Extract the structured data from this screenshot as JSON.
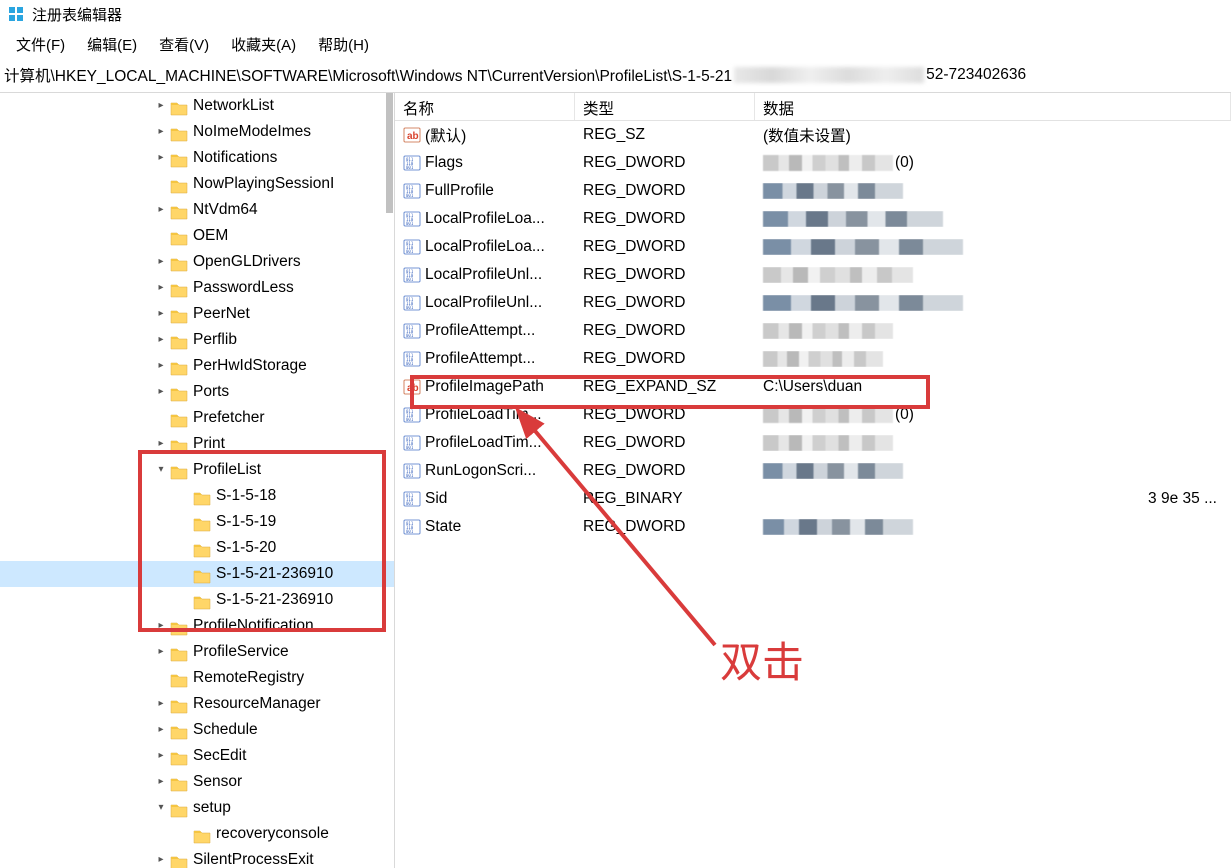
{
  "window": {
    "title": "注册表编辑器"
  },
  "menubar": {
    "file": "文件(F)",
    "edit": "编辑(E)",
    "view": "查看(V)",
    "favorites": "收藏夹(A)",
    "help": "帮助(H)"
  },
  "addressbar": {
    "path_prefix": "计算机\\HKEY_LOCAL_MACHINE\\SOFTWARE\\Microsoft\\Windows NT\\CurrentVersion\\ProfileList\\S-1-5-21",
    "path_suffix": "52-723402636"
  },
  "tree": {
    "items": [
      {
        "indent": 155,
        "expander": ">",
        "label": "NetworkList"
      },
      {
        "indent": 155,
        "expander": ">",
        "label": "NoImeModeImes"
      },
      {
        "indent": 155,
        "expander": ">",
        "label": "Notifications"
      },
      {
        "indent": 155,
        "expander": "",
        "label": "NowPlayingSessionI"
      },
      {
        "indent": 155,
        "expander": ">",
        "label": "NtVdm64"
      },
      {
        "indent": 155,
        "expander": "",
        "label": "OEM"
      },
      {
        "indent": 155,
        "expander": ">",
        "label": "OpenGLDrivers"
      },
      {
        "indent": 155,
        "expander": ">",
        "label": "PasswordLess"
      },
      {
        "indent": 155,
        "expander": ">",
        "label": "PeerNet"
      },
      {
        "indent": 155,
        "expander": ">",
        "label": "Perflib"
      },
      {
        "indent": 155,
        "expander": ">",
        "label": "PerHwIdStorage"
      },
      {
        "indent": 155,
        "expander": ">",
        "label": "Ports"
      },
      {
        "indent": 155,
        "expander": "",
        "label": "Prefetcher"
      },
      {
        "indent": 155,
        "expander": ">",
        "label": "Print"
      },
      {
        "indent": 155,
        "expander": "v",
        "label": "ProfileList"
      },
      {
        "indent": 178,
        "expander": "",
        "label": "S-1-5-18"
      },
      {
        "indent": 178,
        "expander": "",
        "label": "S-1-5-19"
      },
      {
        "indent": 178,
        "expander": "",
        "label": "S-1-5-20"
      },
      {
        "indent": 178,
        "expander": "",
        "label": "S-1-5-21-236910",
        "selected": true
      },
      {
        "indent": 178,
        "expander": "",
        "label": "S-1-5-21-236910"
      },
      {
        "indent": 155,
        "expander": ">",
        "label": "ProfileNotification"
      },
      {
        "indent": 155,
        "expander": ">",
        "label": "ProfileService"
      },
      {
        "indent": 155,
        "expander": "",
        "label": "RemoteRegistry"
      },
      {
        "indent": 155,
        "expander": ">",
        "label": "ResourceManager"
      },
      {
        "indent": 155,
        "expander": ">",
        "label": "Schedule"
      },
      {
        "indent": 155,
        "expander": ">",
        "label": "SecEdit"
      },
      {
        "indent": 155,
        "expander": ">",
        "label": "Sensor"
      },
      {
        "indent": 155,
        "expander": "v",
        "label": "setup"
      },
      {
        "indent": 178,
        "expander": "",
        "label": "recoveryconsole"
      },
      {
        "indent": 155,
        "expander": ">",
        "label": "SilentProcessExit"
      }
    ]
  },
  "list": {
    "columns": {
      "name": "名称",
      "type": "类型",
      "data": "数据"
    },
    "rows": [
      {
        "icon": "ab",
        "name": "(默认)",
        "type": "REG_SZ",
        "data_text": "(数值未设置)",
        "pixelated": false
      },
      {
        "icon": "bin",
        "name": "Flags",
        "type": "REG_DWORD",
        "data_text": "",
        "pixelated": true,
        "pxwidth": 130,
        "suffix": "(0)"
      },
      {
        "icon": "bin",
        "name": "FullProfile",
        "type": "REG_DWORD",
        "data_text": "",
        "pixelated": true,
        "pxwidth": 140,
        "dark": true
      },
      {
        "icon": "bin",
        "name": "LocalProfileLoa...",
        "type": "REG_DWORD",
        "data_text": "",
        "pixelated": true,
        "pxwidth": 180,
        "dark": true
      },
      {
        "icon": "bin",
        "name": "LocalProfileLoa...",
        "type": "REG_DWORD",
        "data_text": "",
        "pixelated": true,
        "pxwidth": 200,
        "dark": true
      },
      {
        "icon": "bin",
        "name": "LocalProfileUnl...",
        "type": "REG_DWORD",
        "data_text": "",
        "pixelated": true,
        "pxwidth": 150
      },
      {
        "icon": "bin",
        "name": "LocalProfileUnl...",
        "type": "REG_DWORD",
        "data_text": "",
        "pixelated": true,
        "pxwidth": 200,
        "dark": true
      },
      {
        "icon": "bin",
        "name": "ProfileAttempt...",
        "type": "REG_DWORD",
        "data_text": "",
        "pixelated": true,
        "pxwidth": 130
      },
      {
        "icon": "bin",
        "name": "ProfileAttempt...",
        "type": "REG_DWORD",
        "data_text": "",
        "pixelated": true,
        "pxwidth": 120
      },
      {
        "icon": "ab",
        "name": "ProfileImagePath",
        "type": "REG_EXPAND_SZ",
        "data_text": "C:\\Users\\duan",
        "pixelated": false,
        "highlighted": true
      },
      {
        "icon": "bin",
        "name": "ProfileLoadTim...",
        "type": "REG_DWORD",
        "data_text": "",
        "pixelated": true,
        "pxwidth": 130,
        "suffix": "(0)"
      },
      {
        "icon": "bin",
        "name": "ProfileLoadTim...",
        "type": "REG_DWORD",
        "data_text": "",
        "pixelated": true,
        "pxwidth": 130
      },
      {
        "icon": "bin",
        "name": "RunLogonScri...",
        "type": "REG_DWORD",
        "data_text": "",
        "pixelated": true,
        "pxwidth": 140,
        "dark": true
      },
      {
        "icon": "bin",
        "name": "Sid",
        "type": "REG_BINARY",
        "data_text": "",
        "pixelated": false,
        "data_tail": "3 9e 35 ..."
      },
      {
        "icon": "bin",
        "name": "State",
        "type": "REG_DWORD",
        "data_text": "",
        "pixelated": true,
        "pxwidth": 150,
        "dark": true
      }
    ]
  },
  "annotation": {
    "text": "双击"
  }
}
